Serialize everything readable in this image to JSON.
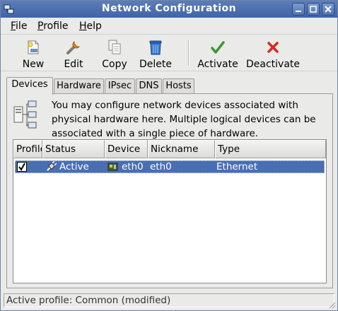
{
  "window": {
    "title": "Network Configuration",
    "minimize_icon": "minimize-icon",
    "maximize_icon": "maximize-icon",
    "close_icon": "close-icon"
  },
  "menubar": {
    "items": [
      {
        "label": "File",
        "mnemonic": "F"
      },
      {
        "label": "Profile",
        "mnemonic": "P"
      },
      {
        "label": "Help",
        "mnemonic": "H"
      }
    ]
  },
  "toolbar": {
    "new_label": "New",
    "edit_label": "Edit",
    "copy_label": "Copy",
    "delete_label": "Delete",
    "activate_label": "Activate",
    "deactivate_label": "Deactivate"
  },
  "tabs": {
    "devices": "Devices",
    "hardware": "Hardware",
    "ipsec": "IPsec",
    "dns": "DNS",
    "hosts": "Hosts",
    "active": "devices"
  },
  "devices_panel": {
    "info": "You may configure network devices associated with physical hardware here.  Multiple logical devices can be associated with a single piece of hardware.",
    "columns": [
      "Profile",
      "Status",
      "Device",
      "Nickname",
      "Type"
    ],
    "rows": [
      {
        "profile_checked": true,
        "status": "Active",
        "device": "eth0",
        "nickname": "eth0",
        "type": "Ethernet",
        "selected": true
      }
    ]
  },
  "statusbar": {
    "text": "Active profile: Common (modified)"
  },
  "colors": {
    "titlebar": "#4a6eb2",
    "selection": "#4a6eb2",
    "window_bg": "#eaeae9"
  }
}
